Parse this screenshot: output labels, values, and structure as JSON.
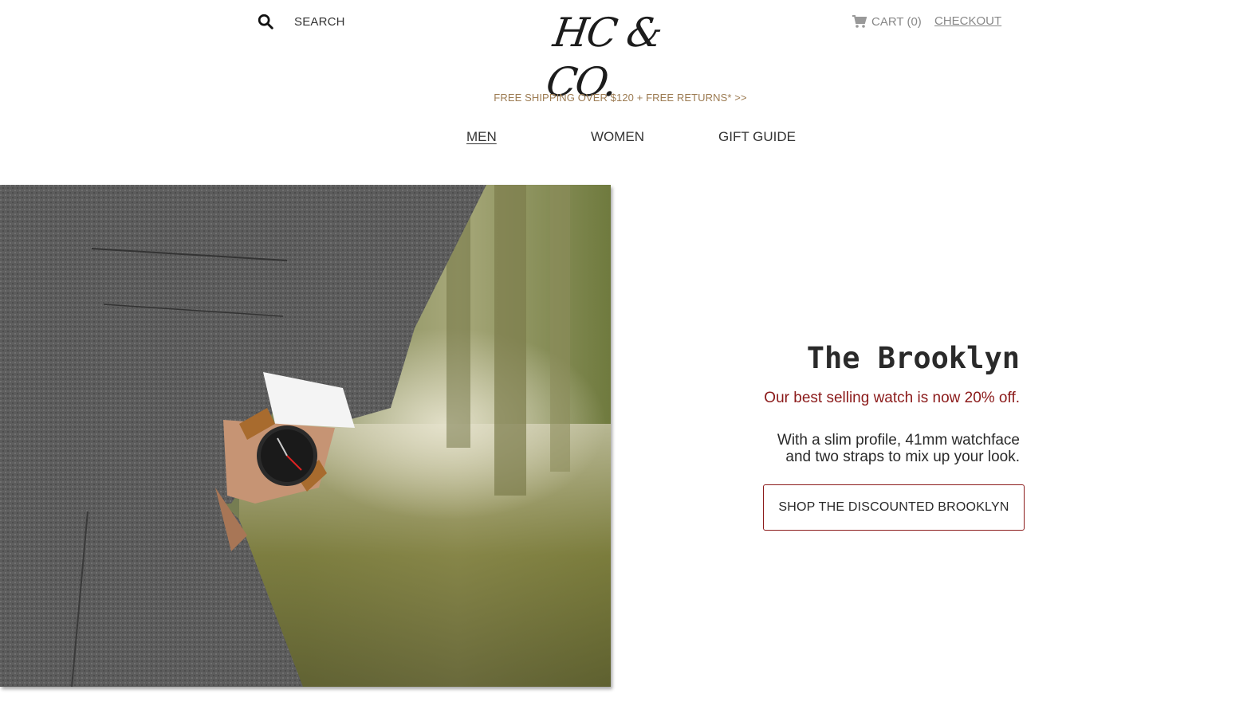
{
  "header": {
    "search_label": "SEARCH",
    "logo_text": "HC & CO.",
    "cart_label": "CART (0)",
    "checkout_label": "CHECKOUT"
  },
  "promo_bar": {
    "text": "FREE SHIPPING OVER $120 + FREE RETURNS* >>"
  },
  "nav": {
    "items": [
      {
        "label": "MEN",
        "active": true
      },
      {
        "label": "WOMEN",
        "active": false
      },
      {
        "label": "GIFT GUIDE",
        "active": false
      }
    ]
  },
  "hero": {
    "image": "man-in-grey-suit-wearing-watch",
    "headline": "The Brooklyn",
    "subhead": "Our best selling watch is now 20% off.",
    "description_line1": "With a slim profile, 41mm watchface",
    "description_line2": "and two straps to mix up your look.",
    "cta_label": "SHOP THE DISCOUNTED BROOKLYN"
  },
  "colors": {
    "accent": "#8b1a1a",
    "promo": "#9c7b52",
    "text": "#333333"
  }
}
